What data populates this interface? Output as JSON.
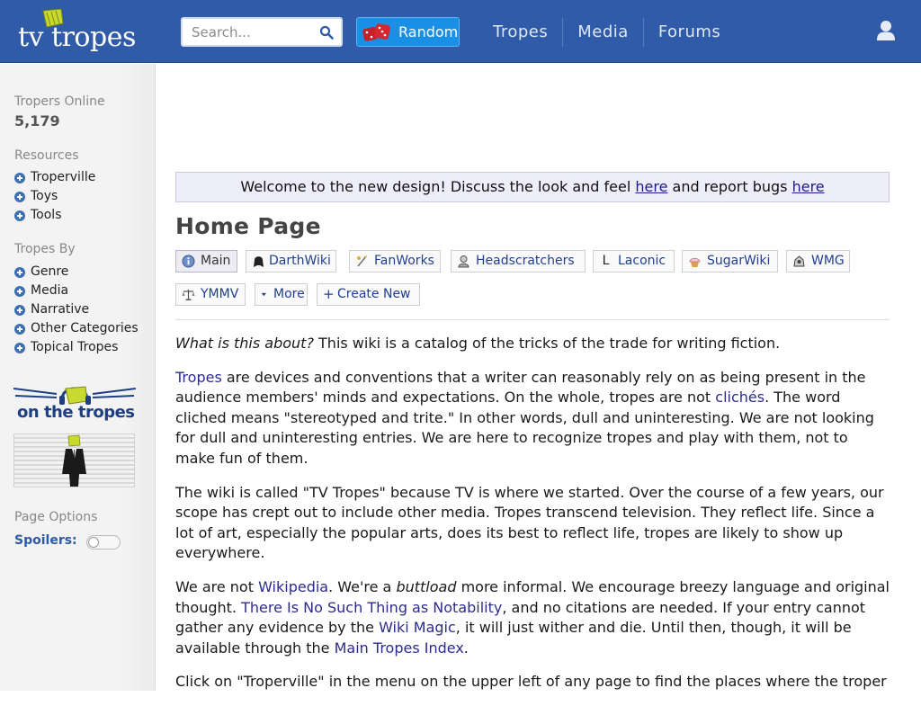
{
  "header": {
    "logo_text": "tv tropes",
    "search_placeholder": "Search...",
    "random_label": "Random",
    "nav": [
      "Tropes",
      "Media",
      "Forums"
    ]
  },
  "sidebar": {
    "online_label": "Tropers Online",
    "online_count": "5,179",
    "resources_label": "Resources",
    "resources": [
      "Troperville",
      "Toys",
      "Tools"
    ],
    "tropes_by_label": "Tropes By",
    "tropes_by": [
      "Genre",
      "Media",
      "Narrative",
      "Other Categories",
      "Topical Tropes"
    ],
    "podcast_logo_text": "on the tropes",
    "page_options_label": "Page Options",
    "spoilers_label": "Spoilers:"
  },
  "notice": {
    "text_1": "Welcome to the new design! Discuss the look and feel ",
    "link_1": "here",
    "text_2": " and report bugs ",
    "link_2": "here"
  },
  "page": {
    "title": "Home Page",
    "tabs": [
      {
        "label": "Main",
        "icon": "info-icon"
      },
      {
        "label": "DarthWiki",
        "icon": "darth-helmet-icon"
      },
      {
        "label": "FanWorks",
        "icon": "fanworks-icon"
      },
      {
        "label": "Headscratchers",
        "icon": "headscratcher-icon"
      },
      {
        "label": "Laconic",
        "icon": "laconic-icon",
        "glyph": "L"
      },
      {
        "label": "SugarWiki",
        "icon": "cupcake-icon"
      },
      {
        "label": "WMG",
        "icon": "wmg-icon"
      },
      {
        "label": "YMMV",
        "icon": "scales-icon"
      },
      {
        "label": "More",
        "icon": "caret-down-icon"
      },
      {
        "label": "Create New",
        "icon": "plus-icon",
        "glyph": "+"
      }
    ]
  },
  "article": {
    "p1": {
      "em": "What is this about?",
      "text": " This wiki is a catalog of the tricks of the trade for writing fiction."
    },
    "p2": {
      "link_tropes": "Tropes",
      "text_a": " are devices and conventions that a writer can reasonably rely on as being present in the audience members' minds and expectations. On the whole, tropes are not ",
      "link_cliches": "clichés",
      "text_b": ". The word cliched means \"stereotyped and trite.\" In other words, dull and uninteresting. We are not looking for dull and uninteresting entries. We are here to recognize tropes and play with them, not to make fun of them."
    },
    "p3": "The wiki is called \"TV Tropes\" because TV is where we started. Over the course of a few years, our scope has crept out to include other media. Tropes transcend television. They reflect life. Since a lot of art, especially the popular arts, does its best to reflect life, tropes are likely to show up everywhere.",
    "p4": {
      "text_a": "We are not ",
      "link_wikipedia": "Wikipedia",
      "text_b": ". We're a ",
      "em_buttload": "buttload",
      "text_c": " more informal. We encourage breezy language and original thought. ",
      "link_notability": "There Is No Such Thing as Notability",
      "text_d": ", and no citations are needed. If your entry cannot gather any evidence by the ",
      "link_wikimagic": "Wiki Magic",
      "text_e": ", it will just wither and die. Until then, though, it will be available through the ",
      "link_index": "Main Tropes Index",
      "text_f": "."
    },
    "p5": "Click on \"Troperville\" in the menu on the upper left of any page to find the places where the troper"
  },
  "colors": {
    "header_bg": "#2f5ba8",
    "random_bg": "#1a8fe6",
    "link": "#2c2c8e",
    "notice_bg": "#eeeefa"
  }
}
